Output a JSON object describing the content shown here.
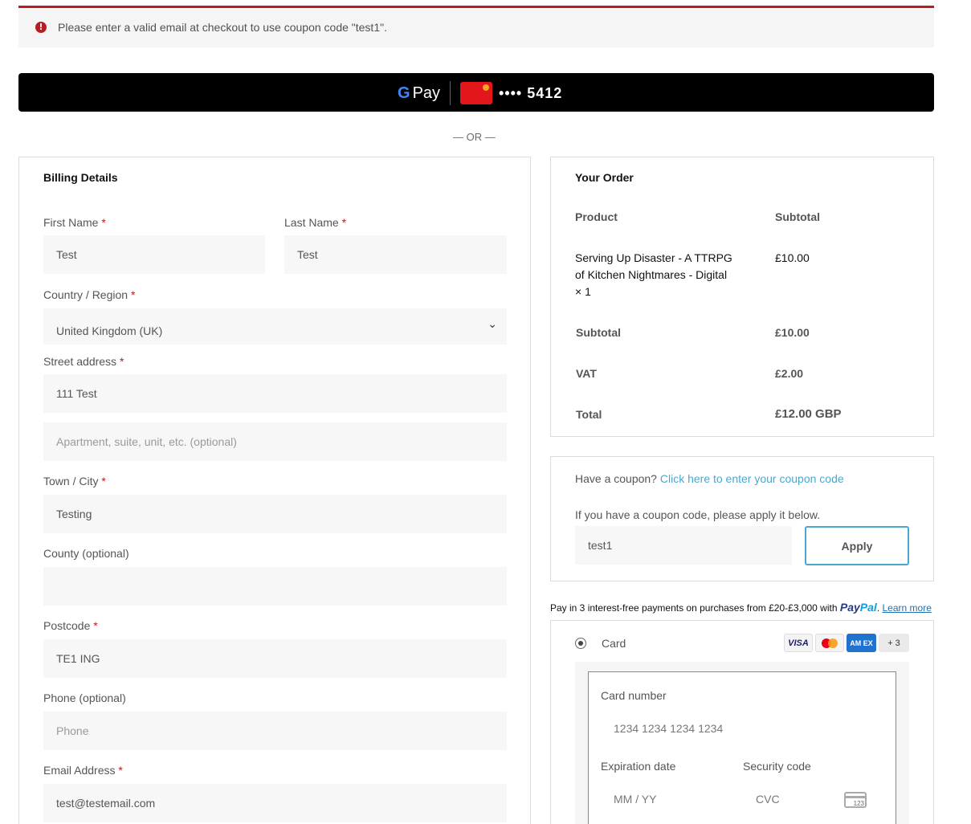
{
  "notice": {
    "message": "Please enter a valid email at checkout to use coupon code \"test1\"."
  },
  "gpay": {
    "g_label": "G",
    "pay_label": "Pay",
    "card_digits": "•••• 5412"
  },
  "separator": {
    "or_text": "— OR —"
  },
  "billing": {
    "title": "Billing Details",
    "first_name": {
      "label": "First Name",
      "required": "*",
      "value": "Test"
    },
    "last_name": {
      "label": "Last Name",
      "required": "*",
      "value": "Test"
    },
    "country": {
      "label": "Country / Region",
      "required": "*",
      "value": "United Kingdom (UK)"
    },
    "street": {
      "label": "Street address",
      "required": "*",
      "value": "111 Test",
      "apartment_placeholder": "Apartment, suite, unit, etc. (optional)"
    },
    "town": {
      "label": "Town / City",
      "required": "*",
      "value": "Testing"
    },
    "county": {
      "label": "County (optional)",
      "value": ""
    },
    "postcode": {
      "label": "Postcode",
      "required": "*",
      "value": "TE1 ING"
    },
    "phone": {
      "label": "Phone (optional)",
      "placeholder": "Phone"
    },
    "email": {
      "label": "Email Address",
      "required": "*",
      "value": "test@testemail.com"
    }
  },
  "order": {
    "title": "Your Order",
    "col_product": "Product",
    "col_subtotal": "Subtotal",
    "item": {
      "line1": "Serving Up Disaster - A TTRPG",
      "line2": "of Kitchen Nightmares - Digital",
      "line3": "× 1",
      "price": "£10.00"
    },
    "subtotal_label": "Subtotal",
    "subtotal_value": "£10.00",
    "vat_label": "VAT",
    "vat_value": "£2.00",
    "total_label": "Total",
    "total_value": "£12.00 GBP"
  },
  "coupon": {
    "prompt": "Have a coupon?",
    "link": "Click here to enter your coupon code",
    "instructions": "If you have a coupon code, please apply it below.",
    "value": "test1",
    "apply_label": "Apply"
  },
  "paypal": {
    "text": "Pay in 3 interest-free payments on purchases from £20-£3,000 with",
    "logo_pay": "Pay",
    "logo_pal": "Pal",
    "learn_more": "Learn more"
  },
  "payment": {
    "method_label": "Card",
    "brands": {
      "visa": "VISA",
      "amex": "AM EX",
      "more": "+ 3"
    },
    "card_number_label": "Card number",
    "card_number_placeholder": "1234 1234 1234 1234",
    "expiry_label": "Expiration date",
    "expiry_placeholder": "MM / YY",
    "security_label": "Security code",
    "cvc_placeholder": "CVC",
    "cvc_icon_text": "123"
  },
  "colors": {
    "error": "#b81c23",
    "link": "#4aa8cf",
    "gpay_bg": "#000000"
  }
}
